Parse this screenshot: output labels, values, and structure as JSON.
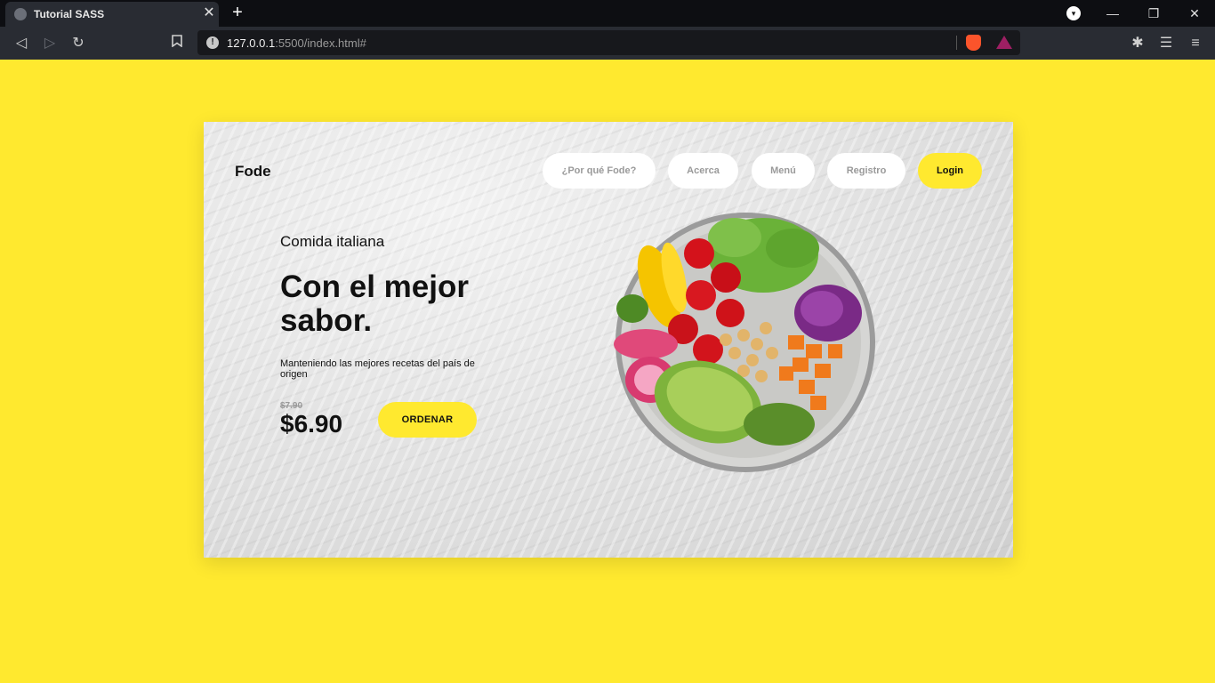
{
  "browser": {
    "tab_title": "Tutorial SASS",
    "tab_close": "✕",
    "new_tab": "+",
    "url_host": "127.0.0.1",
    "url_rest": ":5500/index.html#",
    "url_info": "!",
    "window_controls": {
      "minimize": "—",
      "restore": "❐",
      "close": "✕"
    },
    "toolbar_icons": [
      "back-icon",
      "forward-icon",
      "reload-icon",
      "bookmark-icon",
      "extensions-icon",
      "playlist-icon",
      "menu-icon"
    ]
  },
  "page": {
    "logo": "Fode",
    "nav": [
      "¿Por qué Fode?",
      "Acerca",
      "Menú",
      "Registro"
    ],
    "login": "Login",
    "subtitle": "Comida italiana",
    "headline": "Con el mejor sabor.",
    "description": "Manteniendo las mejores recetas del país de origen",
    "old_price": "$7.90",
    "price": "$6.90",
    "order_button": "ORDENAR"
  },
  "colors": {
    "accent": "#ffe92f",
    "text": "#111111",
    "muted": "#9a9a9a"
  }
}
